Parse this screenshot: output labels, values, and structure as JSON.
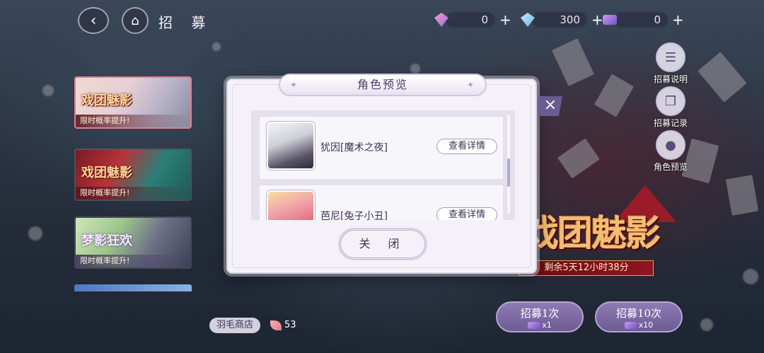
{
  "header": {
    "title": "招 募",
    "back_icon": "back-arrow-icon",
    "home_icon": "tent-home-icon"
  },
  "currencies": [
    {
      "icon": "pink-gem-icon",
      "value": "0"
    },
    {
      "icon": "blue-diamond-icon",
      "value": "300"
    },
    {
      "icon": "recruit-ticket-icon",
      "value": "0"
    }
  ],
  "banners": [
    {
      "logo": "戏团魅影",
      "tag": "限时概率提升!",
      "active": true
    },
    {
      "logo": "戏团魅影",
      "tag": "限时概率提升!",
      "active": false
    },
    {
      "logo": "梦影狂欢",
      "tag": "限时概率提升!",
      "active": false
    }
  ],
  "side_buttons": [
    {
      "label": "招募说明",
      "icon": "clipboard-icon"
    },
    {
      "label": "招募记录",
      "icon": "cards-icon"
    },
    {
      "label": "角色预览",
      "icon": "person-icon"
    }
  ],
  "event": {
    "logo": "戏团魅影",
    "countdown": "剩余5天12小时38分"
  },
  "recruit": {
    "single": {
      "label": "招募1次",
      "cost": "x1"
    },
    "ten": {
      "label": "招募10次",
      "cost": "x10"
    }
  },
  "shop": {
    "label": "羽毛商店",
    "feathers": "53"
  },
  "modal": {
    "title": "角色预览",
    "characters": [
      {
        "name": "犹因[魔术之夜]",
        "action": "查看详情"
      },
      {
        "name": "芭尼[兔子小丑]",
        "action": "查看详情"
      }
    ],
    "close_label": "关 闭"
  },
  "colors": {
    "modal_bg": "#f4f2f8",
    "accent_purple": "#6d5b93",
    "event_red": "#9c1b2a"
  }
}
